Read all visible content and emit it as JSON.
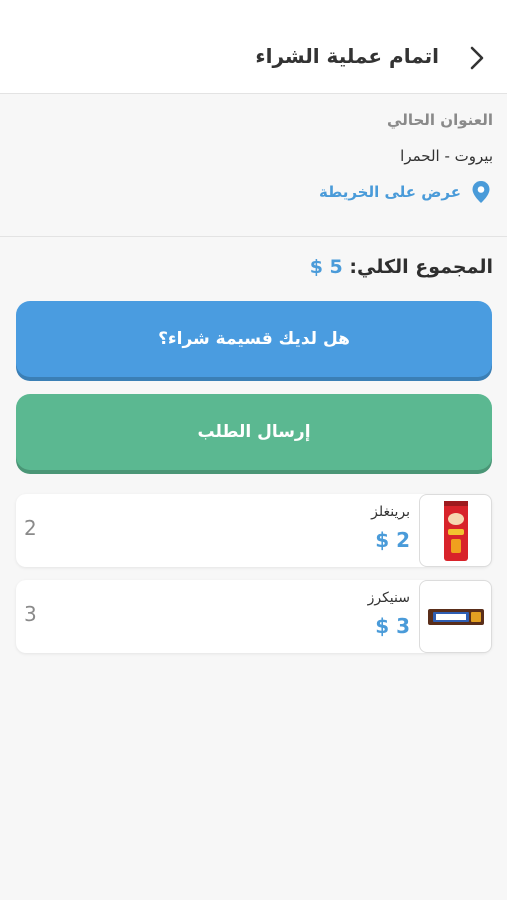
{
  "header": {
    "title": "اتمام عملية الشراء"
  },
  "address": {
    "label": "العنوان الحالي",
    "value": "بيروت - الحمرا",
    "map_link": "عرض على الخريطة"
  },
  "total": {
    "label": "المجموع الكلي:",
    "amount": "5 $"
  },
  "buttons": {
    "coupon": "هل لديك قسيمة شراء؟",
    "submit": "إرسال الطلب"
  },
  "items": [
    {
      "name": "برينغلز",
      "price": "2 $",
      "qty": "2",
      "image": "pringles-can"
    },
    {
      "name": "سنيكرز",
      "price": "3 $",
      "qty": "3",
      "image": "snickers-bar"
    }
  ],
  "colors": {
    "accent_blue": "#4a9bd9",
    "coupon_button": "#4a9ce0",
    "submit_button": "#5bb891"
  }
}
